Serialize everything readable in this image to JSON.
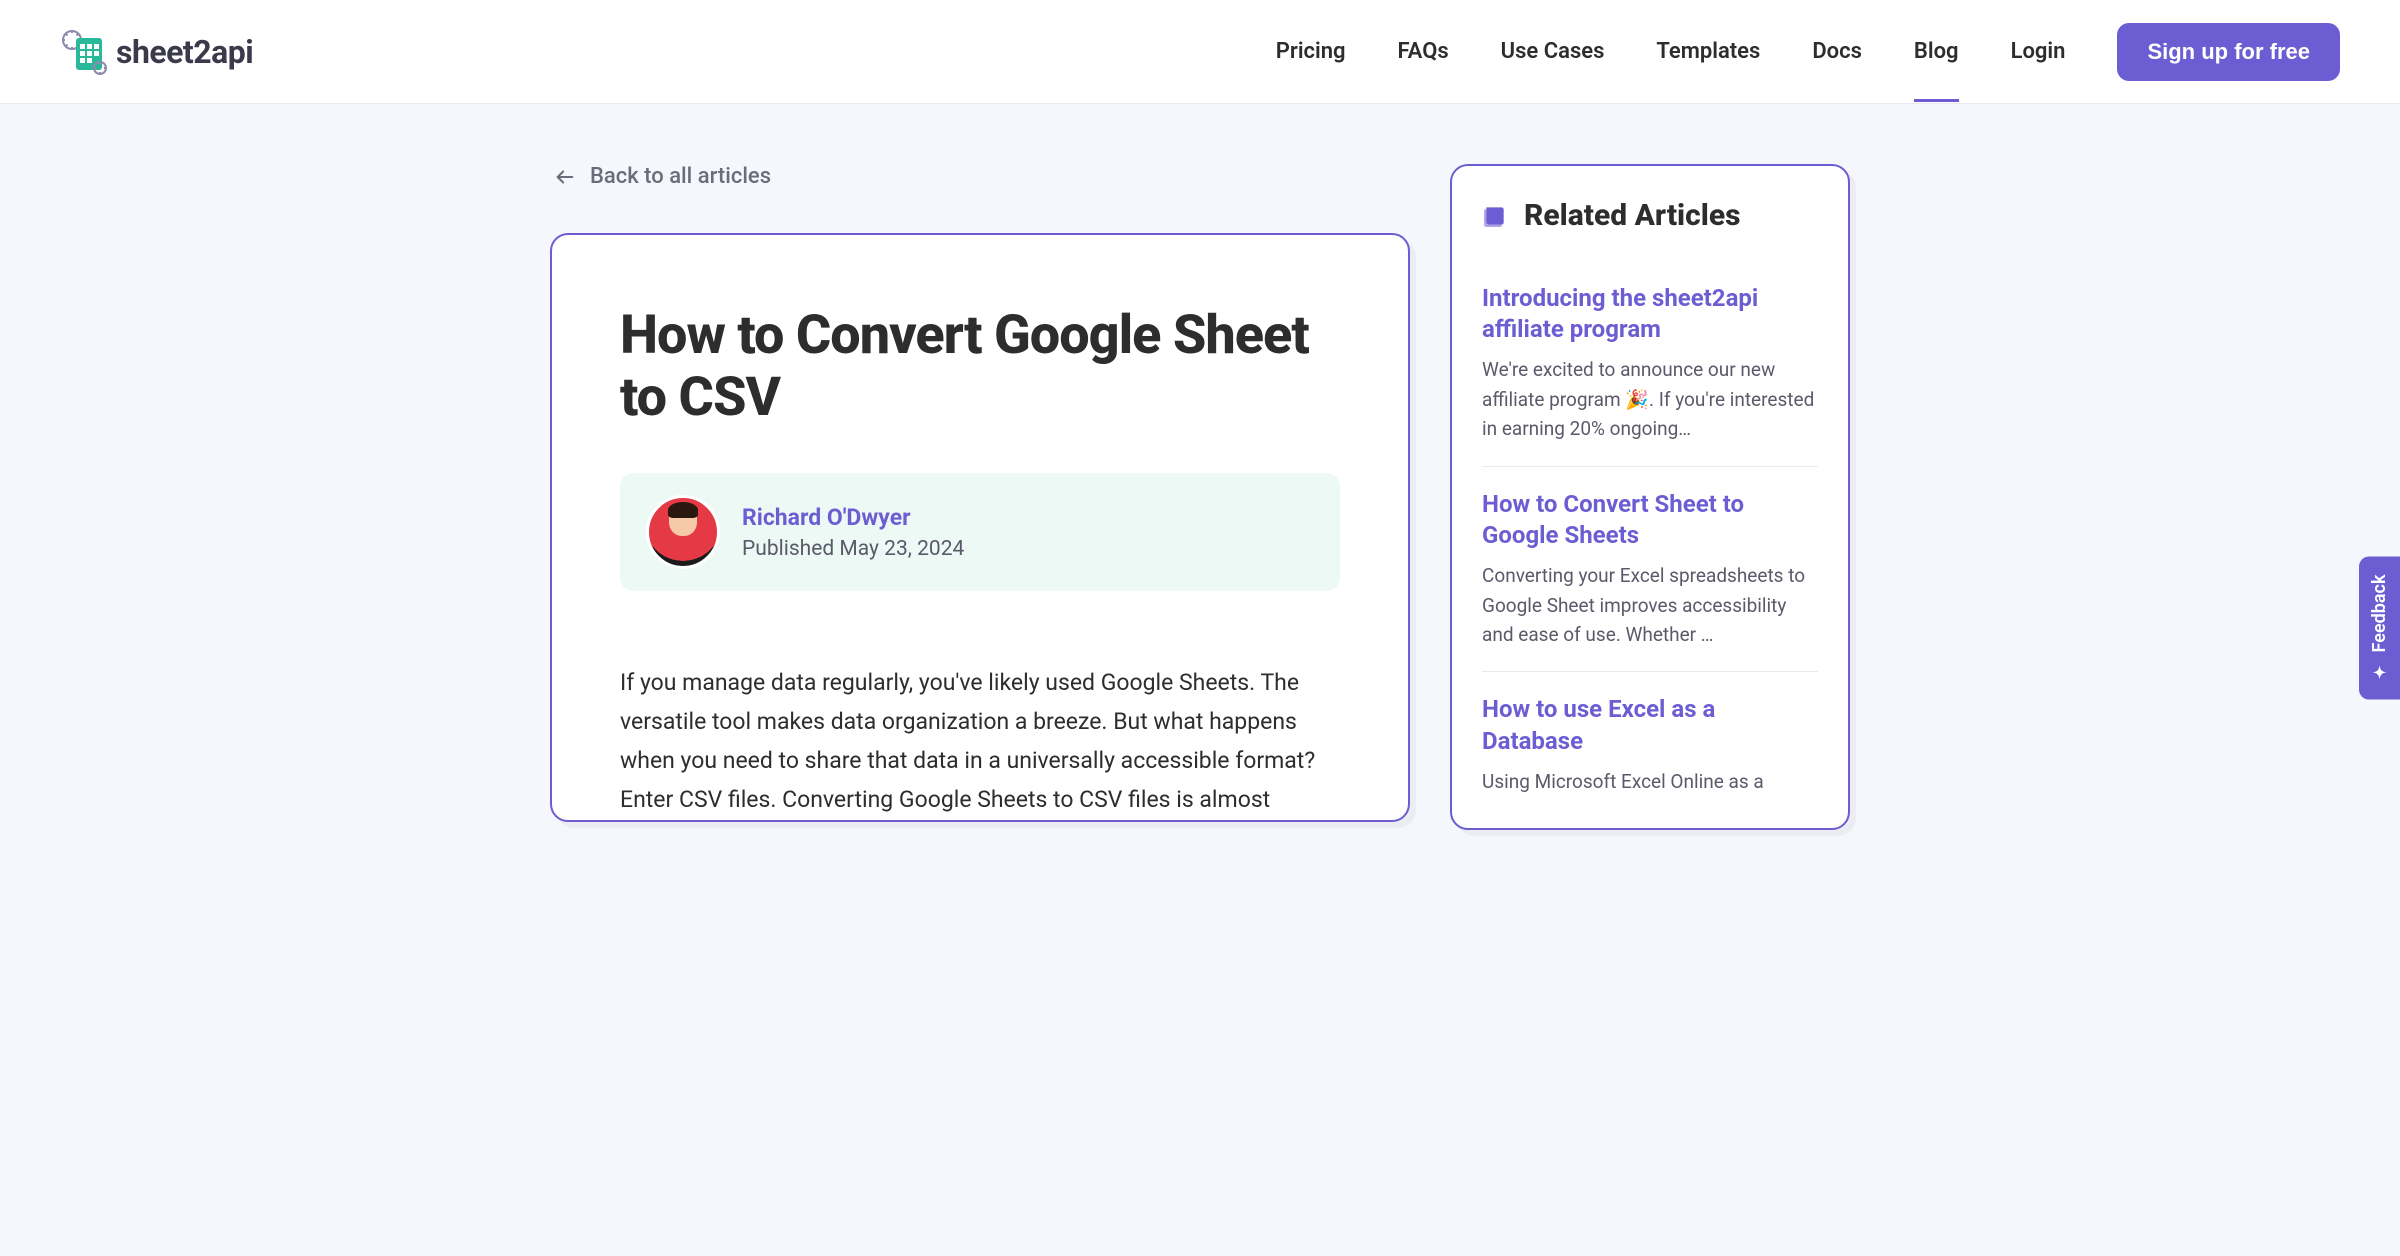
{
  "brand": "sheet2api",
  "nav": {
    "items": [
      "Pricing",
      "FAQs",
      "Use Cases",
      "Templates",
      "Docs",
      "Blog",
      "Login"
    ],
    "active": "Blog",
    "cta": "Sign up for free"
  },
  "back_link": "Back to all articles",
  "article": {
    "title": "How to Convert Google Sheet to CSV",
    "author": "Richard O'Dwyer",
    "published": "Published May 23, 2024",
    "body": "If you manage data regularly, you've likely used Google Sheets. The versatile tool makes data organization a breeze. But what happens when you need to share that data in a universally accessible format? Enter CSV files. Converting Google Sheets to CSV files is almost"
  },
  "sidebar": {
    "heading": "Related Articles",
    "items": [
      {
        "title": "Introducing the sheet2api affiliate program",
        "desc": "We're excited to announce our new affiliate program 🎉. If you're interested in earning 20% ongoing…"
      },
      {
        "title": "How to Convert Sheet to Google Sheets",
        "desc": "Converting your Excel spreadsheets to Google Sheet improves accessibility and ease of use. Whether …"
      },
      {
        "title": "How to use Excel as a Database",
        "desc": "Using Microsoft Excel Online as a"
      }
    ]
  },
  "feedback": "Feedback"
}
